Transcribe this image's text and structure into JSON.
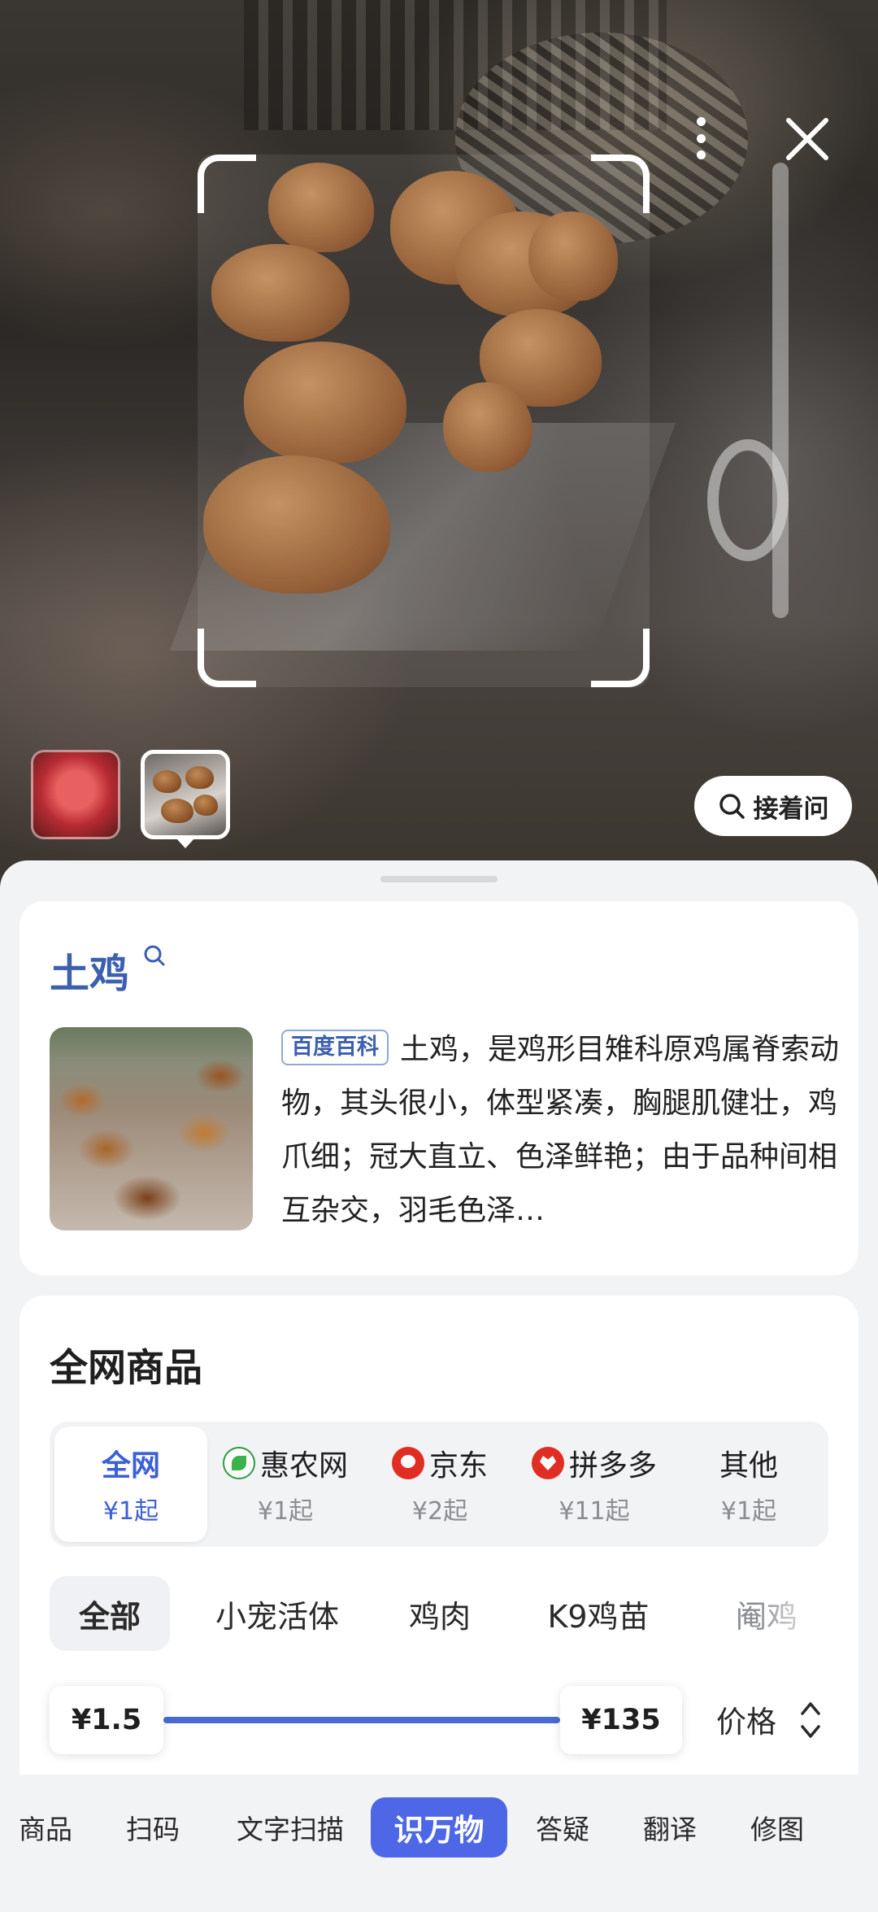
{
  "camera": {
    "more_icon": "more-vertical-icon",
    "close_icon": "close-icon",
    "ask_button_label": "接着问",
    "ask_icon": "search-icon"
  },
  "wiki": {
    "title": "土鸡",
    "source_tag": "百度百科",
    "description": "土鸡，是鸡形目雉科原鸡属脊索动物，其头很小，体型紧凑，胸腿肌健壮，鸡爪细；冠大直立、色泽鲜艳；由于品种间相互杂交，羽毛色泽…"
  },
  "shop": {
    "title": "全网商品",
    "platforms": [
      {
        "name": "全网",
        "price": "¥1起",
        "logo": ""
      },
      {
        "name": "惠农网",
        "price": "¥1起",
        "logo": "huinong-logo-icon"
      },
      {
        "name": "京东",
        "price": "¥2起",
        "logo": "jd-logo-icon"
      },
      {
        "name": "拼多多",
        "price": "¥11起",
        "logo": "pinduoduo-logo-icon"
      },
      {
        "name": "其他",
        "price": "¥1起",
        "logo": ""
      }
    ],
    "categories": [
      "全部",
      "小宠活体",
      "鸡肉",
      "K9鸡苗",
      "阉鸡"
    ],
    "price_min": "¥1.5",
    "price_max": "¥135",
    "sort_label": "价格"
  },
  "tabs": [
    "商品",
    "扫码",
    "文字扫描",
    "识万物",
    "答疑",
    "翻译",
    "修图"
  ],
  "colors": {
    "accent": "#4d67e6",
    "wiki_title": "#3c5fb0"
  }
}
